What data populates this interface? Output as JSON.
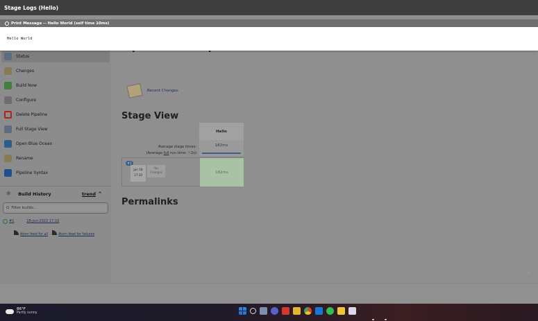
{
  "dialog": {
    "title": "Stage Logs (Hello)",
    "step_label": "Print Message -- Hello World (self time 10ms)",
    "log_output": "Hello World"
  },
  "page": {
    "title": "Pipeline First Pipeline",
    "recent_changes": "Recent Changes",
    "stage_view_title": "Stage View",
    "permalinks_title": "Permalinks"
  },
  "sidebar": {
    "items": [
      {
        "label": "Status",
        "icon": "magnifier-icon"
      },
      {
        "label": "Changes",
        "icon": "notepad-icon"
      },
      {
        "label": "Build Now",
        "icon": "clock-play-icon"
      },
      {
        "label": "Configure",
        "icon": "gear-icon"
      },
      {
        "label": "Delete Pipeline",
        "icon": "no-entry-icon"
      },
      {
        "label": "Full Stage View",
        "icon": "magnifier-icon"
      },
      {
        "label": "Open Blue Ocean",
        "icon": "blue-ocean-icon"
      },
      {
        "label": "Rename",
        "icon": "notepad-icon"
      },
      {
        "label": "Pipeline Syntax",
        "icon": "help-icon"
      }
    ]
  },
  "build_history": {
    "title": "Build History",
    "trend_label": "trend",
    "filter_placeholder": "Filter builds...",
    "builds": [
      {
        "number": "#1",
        "date": "18-Jun-2022 17:10",
        "status": "success"
      }
    ],
    "atom_all": "Atom feed for all",
    "atom_failures": "Atom feed for failures"
  },
  "stage_view": {
    "stage_name": "Hello",
    "avg_stage_times_label": "Average stage times:",
    "avg_run_prefix": "(Average ",
    "avg_run_full": "full",
    "avg_run_suffix": " run time: ~2s)",
    "avg_time": "182ms",
    "run": {
      "badge": "#1",
      "date": "Jun 18",
      "time": "17:10",
      "no_changes_line1": "No",
      "no_changes_line2": "Changes",
      "stage_time": "182ms"
    }
  },
  "taskbar": {
    "temperature": "86°F",
    "weather_condition": "Partly sunny",
    "icons": [
      "windows-start-icon",
      "search-icon",
      "widgets-icon",
      "teams-icon",
      "acrobat-icon",
      "file-explorer-icon",
      "chrome-icon",
      "outlook-icon",
      "whatsapp-icon",
      "sticky-notes-icon",
      "remote-desktop-icon"
    ]
  },
  "colors": {
    "dialog_title_bg": "#3f3f3f",
    "stage_success_bg": "#a9c1a4",
    "page_dim_bg": "#8f8f8f"
  }
}
